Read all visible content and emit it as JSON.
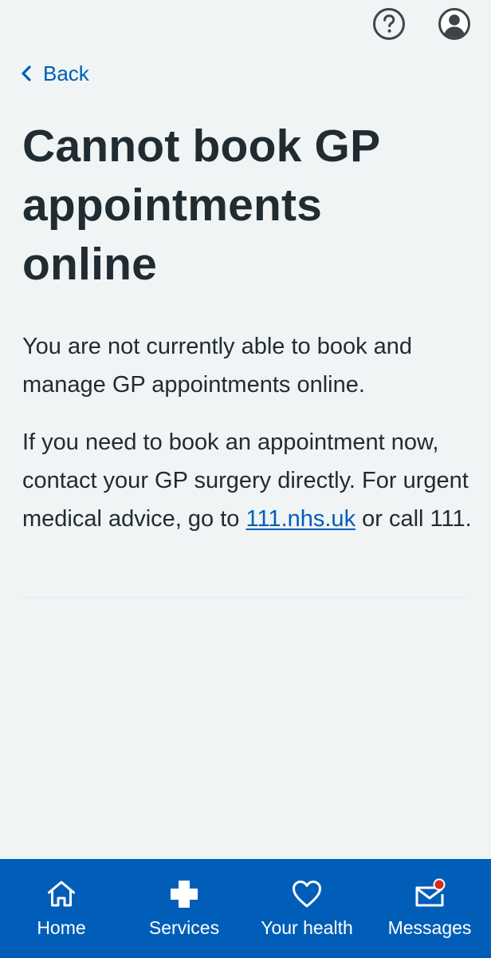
{
  "header": {
    "icons": [
      "help-icon",
      "account-icon"
    ]
  },
  "back": {
    "label": "Back",
    "icon": "chevron-left-icon"
  },
  "page": {
    "title": "Cannot book GP appointments online",
    "paragraph1": "You are not currently able to book and manage GP appointments online.",
    "paragraph2_before_link": "If you need to book an appointment now, contact your GP surgery directly. For urgent medical advice, go to ",
    "paragraph2_link": "111.nhs.uk",
    "paragraph2_after_link": " or call 111."
  },
  "nav": {
    "items": [
      {
        "label": "Home",
        "icon": "home-icon"
      },
      {
        "label": "Services",
        "icon": "plus-icon"
      },
      {
        "label": "Your health",
        "icon": "heart-icon"
      },
      {
        "label": "Messages",
        "icon": "messages-icon"
      }
    ]
  },
  "colors": {
    "background": "#f0f4f5",
    "text": "#212b32",
    "link": "#005eb8",
    "nav_background": "#005eb8",
    "notification": "#da291c"
  }
}
